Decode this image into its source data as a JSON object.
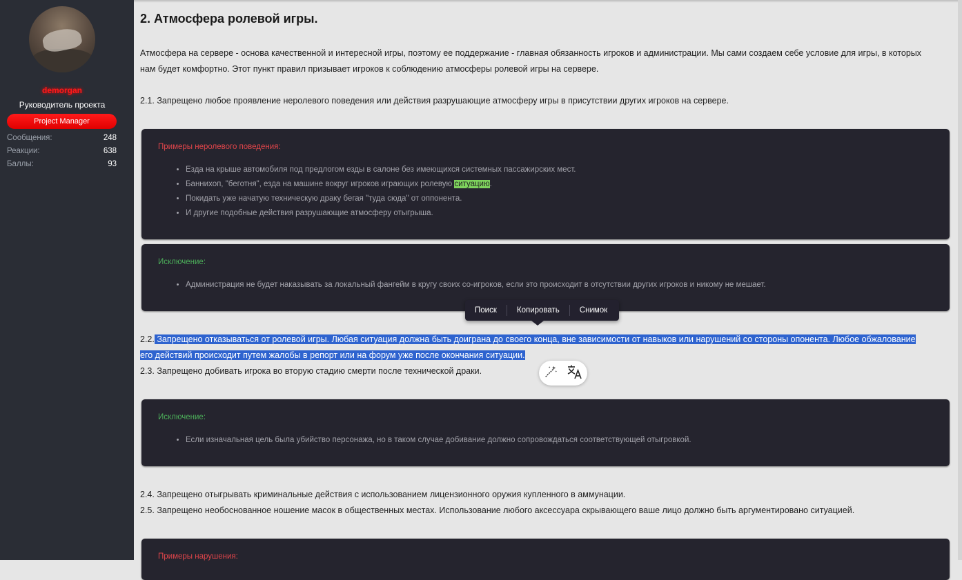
{
  "user": {
    "name": "demorgan",
    "title": "Руководитель проекта",
    "banner": "Project Manager",
    "stats": [
      {
        "label": "Сообщения:",
        "value": "248"
      },
      {
        "label": "Реакции:",
        "value": "638"
      },
      {
        "label": "Баллы:",
        "value": "93"
      }
    ]
  },
  "post": {
    "heading": "2. Атмосфера ролевой игры.",
    "intro_line1": "Атмосфера на сервере - основа качественной и интересной игры, поэтому ее поддержание - главная обязанность игроков и администрации. Мы сами создаем себе условие для игры, в которых",
    "intro_line2": "нам будет комфортно. Этот пункт правил призывает игроков к соблюдению атмосферы ролевой игры на сервере.",
    "rule_2_1": "2.1. Запрещено любое проявление неролевого поведения или действия разрушающие атмосферу игры в присутствии других игроков на сервере.",
    "box1": {
      "title": "Примеры неролевого поведения:",
      "item1": "Езда на крыше автомобиля под предлогом езды в салоне без имеющихся системных пассажирских мест.",
      "item2_before": "Баннихоп, \"беготня\", езда на машине вокруг игроков играющих ролевую ",
      "item2_highlight": "ситуацию",
      "item2_after": ".",
      "item3": "Покидать уже начатую техническую драку бегая \"туда сюда\" от оппонента.",
      "item4": "И другие подобные действия разрушающие атмосферу отыгрыша."
    },
    "box2": {
      "title": "Исключение:",
      "item1": "Администрация не будет наказывать за локальный фангейм в кругу своих со-игроков, если это происходит в отсутствии других игроков и никому не мешает."
    },
    "rule_2_2_num": "2.2.",
    "rule_2_2_line1": " Запрещено отказываться от ролевой игры. Любая ситуация должна быть доиграна до своего конца, вне зависимости от навыков или нарушений со стороны опонента. Любое обжалование",
    "rule_2_2_line2": "его действий происходит путем жалобы в репорт или на форум уже после окончания ситуации.",
    "rule_2_3": "2.3. Запрещено добивать игрока во вторую стадию смерти после технической драки.",
    "box3": {
      "title": "Исключение:",
      "item1": "Если изначальная цель была убийство персонажа, но в таком случае добивание должно сопровождаться соответствующей отыгровкой."
    },
    "rule_2_4": "2.4. Запрещено отыгрывать криминальные действия с использованием лицензионного оружия купленного в аммунации.",
    "rule_2_5": "2.5. Запрещено необоснованное ношение масок в общественных местах. Использование любого аксессуара скрывающего ваше лицо должно быть аргументировано ситуацией.",
    "box4": {
      "title": "Примеры нарушения:"
    }
  },
  "popup": {
    "search": "Поиск",
    "copy": "Копировать",
    "snapshot": "Снимок"
  },
  "minitool": {
    "icons": [
      "magic-wand-icon",
      "translate-icon"
    ]
  },
  "colors": {
    "sidebar": "#2a2d35",
    "page": "#e6e6e6",
    "box": "#25242e",
    "username": "#ff1a1a",
    "selection": "#2e63cf",
    "red_title": "#e0454a",
    "green_title": "#4caf5a",
    "highlight": "#7ed35d"
  }
}
